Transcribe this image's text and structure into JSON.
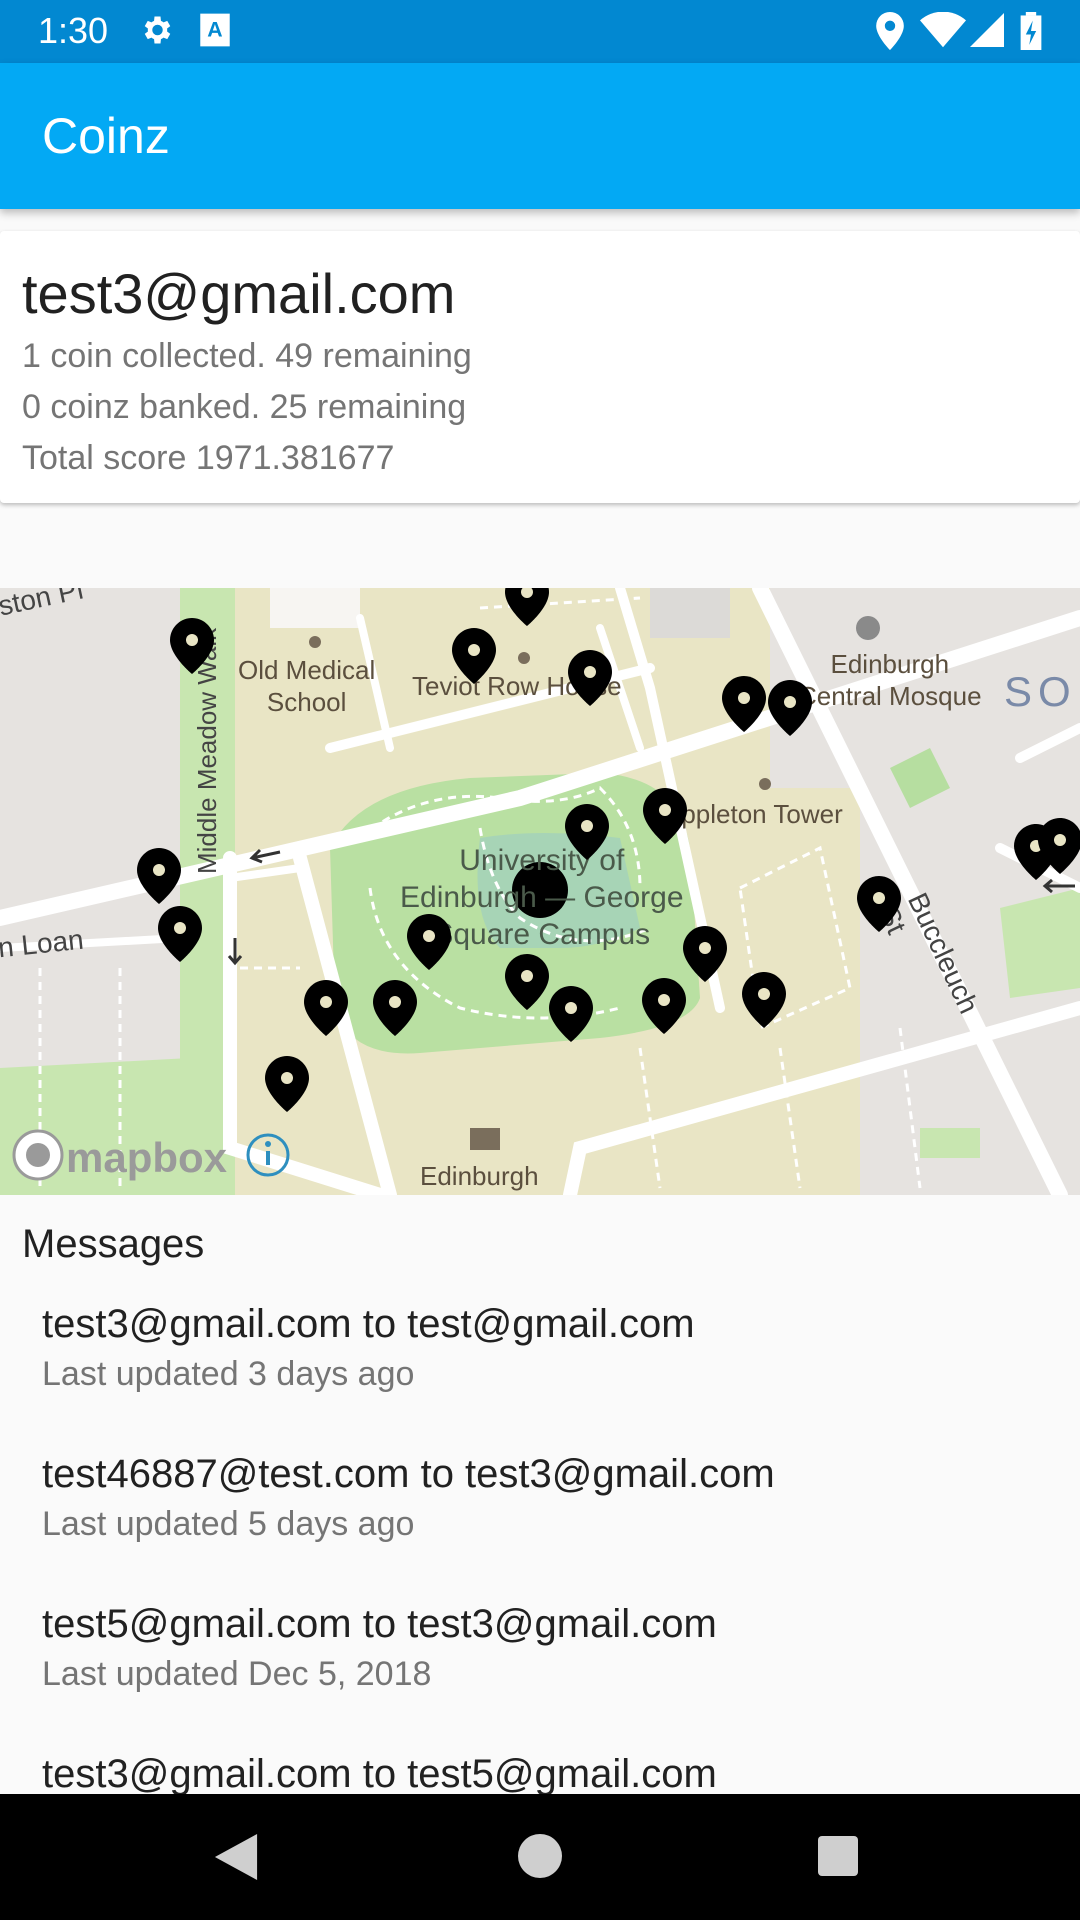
{
  "status_bar": {
    "time": "1:30",
    "icons": [
      "settings-icon",
      "keyboard-a-icon",
      "location-icon",
      "wifi-icon",
      "signal-icon",
      "battery-charging-icon"
    ]
  },
  "app_bar": {
    "title": "Coinz"
  },
  "user_card": {
    "email": "test3@gmail.com",
    "coins_collected": "1 coin collected. 49 remaining",
    "coins_banked": "0 coinz banked. 25 remaining",
    "total_score": "Total score 1971.381677"
  },
  "map": {
    "labels": {
      "old_medical_school": "Old Medical\nSchool",
      "teviot_row_house": "Teviot Row House",
      "edinburgh_central_mosque": "Edinburgh\nCentral Mosque",
      "appleton_tower": "Appleton Tower",
      "university_george_square": "University of\nEdinburgh — George\nSquare Campus",
      "edinburgh": "Edinburgh",
      "middle_meadow_walk": "Middle Meadow Walk",
      "buccleuch_st": "Buccleuch St",
      "ston_pl": "ston Pl",
      "loan": "n Loan",
      "so": "SO"
    },
    "attribution": {
      "brand": "mapbox",
      "info_icon": "info-icon"
    },
    "coin_markers": 24
  },
  "messages": {
    "title": "Messages",
    "items": [
      {
        "title": "test3@gmail.com to test@gmail.com",
        "subtitle": "Last updated 3 days ago"
      },
      {
        "title": "test46887@test.com to test3@gmail.com",
        "subtitle": "Last updated 5 days ago"
      },
      {
        "title": "test5@gmail.com to test3@gmail.com",
        "subtitle": "Last updated Dec 5, 2018"
      },
      {
        "title": "test3@gmail.com to test5@gmail.com",
        "subtitle": ""
      }
    ]
  },
  "nav_bar": {
    "icons": [
      "back-icon",
      "home-icon",
      "recents-icon"
    ]
  }
}
